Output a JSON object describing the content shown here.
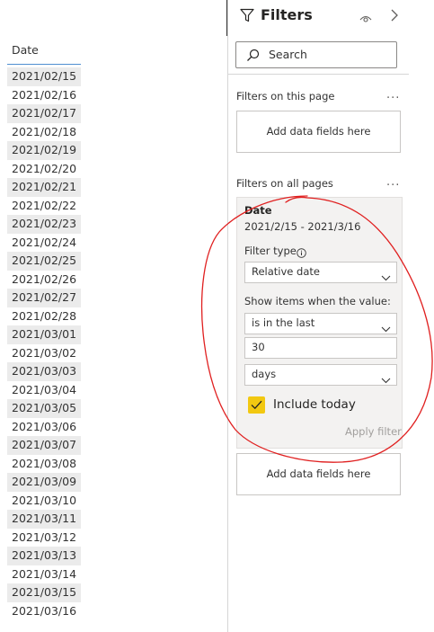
{
  "table": {
    "header": "Date",
    "rows": [
      "2021/02/15",
      "2021/02/16",
      "2021/02/17",
      "2021/02/18",
      "2021/02/19",
      "2021/02/20",
      "2021/02/21",
      "2021/02/22",
      "2021/02/23",
      "2021/02/24",
      "2021/02/25",
      "2021/02/26",
      "2021/02/27",
      "2021/02/28",
      "2021/03/01",
      "2021/03/02",
      "2021/03/03",
      "2021/03/04",
      "2021/03/05",
      "2021/03/06",
      "2021/03/07",
      "2021/03/08",
      "2021/03/09",
      "2021/03/10",
      "2021/03/11",
      "2021/03/12",
      "2021/03/13",
      "2021/03/14",
      "2021/03/15",
      "2021/03/16"
    ]
  },
  "filters": {
    "title": "Filters",
    "search_placeholder": "Search",
    "this_page": {
      "label": "Filters on this page",
      "more": "...",
      "drop_zone": "Add data fields here"
    },
    "all_pages": {
      "label": "Filters on all pages",
      "more": "...",
      "drop_zone": "Add data fields here"
    },
    "card": {
      "title": "Date",
      "range": "2021/2/15 - 2021/3/16",
      "filter_type_label": "Filter type",
      "filter_type_value": "Relative date",
      "show_items_label": "Show items when the value:",
      "condition_value": "is in the last",
      "amount_value": "30",
      "unit_value": "days",
      "include_today_label": "Include today",
      "include_today_checked": true,
      "apply_label": "Apply filter"
    }
  },
  "colors": {
    "checkbox_fill": "#f2c811",
    "annotation_stroke": "#e02020",
    "header_underline": "#4f8fd1"
  }
}
